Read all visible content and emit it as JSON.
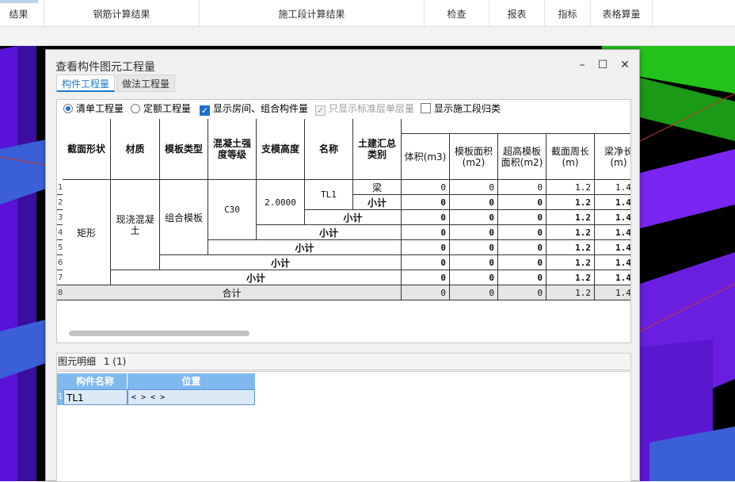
{
  "ribbon": {
    "items": [
      "结果",
      "钢筋计算结果",
      "施工段计算结果",
      "检查",
      "报表",
      "指标",
      "表格算量"
    ]
  },
  "dialog": {
    "title": "查看构件图元工程量",
    "minimize_glyph": "–",
    "maximize_glyph": "☐",
    "close_glyph": "✕",
    "tabs": [
      {
        "label": "构件工程量",
        "active": true
      },
      {
        "label": "做法工程量",
        "active": false
      }
    ],
    "options": [
      {
        "label": "清单工程量",
        "type": "radio",
        "checked": true
      },
      {
        "label": "定额工程量",
        "type": "radio",
        "checked": false
      },
      {
        "label": "显示房间、组合构件量",
        "type": "checkbox",
        "checked": true
      },
      {
        "label": "只显示标准层单层量",
        "type": "checkbox",
        "checked": true,
        "disabled": true
      },
      {
        "label": "显示施工段归类",
        "type": "checkbox",
        "checked": false
      }
    ],
    "table": {
      "headers": [
        "截面形状",
        "材质",
        "模板类型",
        "混凝土强度等级",
        "支模高度",
        "名称",
        "土建汇总类别",
        "体积(m3)",
        "模板面积(m2)",
        "超高模板面积(m2)",
        "截面周长(m)",
        "梁净长(m)"
      ],
      "row_numbers": [
        "1",
        "2",
        "3",
        "4",
        "5",
        "6",
        "7",
        "8"
      ],
      "section_shape": "矩形",
      "material": "现浇混凝土",
      "formwork_type": "组合模板",
      "concrete_grade": "C30",
      "formwork_height": "2.0000",
      "name": "TL1",
      "category": "梁",
      "subtotal_label": "小计",
      "total_label": "合计",
      "rows": [
        {
          "volume": "0",
          "formwork_area": "0",
          "super_area": "0",
          "perimeter": "1.2",
          "length": "1.4"
        },
        {
          "volume": "0",
          "formwork_area": "0",
          "super_area": "0",
          "perimeter": "1.2",
          "length": "1.4"
        },
        {
          "volume": "0",
          "formwork_area": "0",
          "super_area": "0",
          "perimeter": "1.2",
          "length": "1.4"
        },
        {
          "volume": "0",
          "formwork_area": "0",
          "super_area": "0",
          "perimeter": "1.2",
          "length": "1.4"
        },
        {
          "volume": "0",
          "formwork_area": "0",
          "super_area": "0",
          "perimeter": "1.2",
          "length": "1.4"
        },
        {
          "volume": "0",
          "formwork_area": "0",
          "super_area": "0",
          "perimeter": "1.2",
          "length": "1.4"
        },
        {
          "volume": "0",
          "formwork_area": "0",
          "super_area": "0",
          "perimeter": "1.2",
          "length": "1.4"
        },
        {
          "volume": "0",
          "formwork_area": "0",
          "super_area": "0",
          "perimeter": "1.2",
          "length": "1.4"
        }
      ]
    },
    "detail": {
      "label": "图元明细",
      "count": "1 (1)",
      "headers": [
        "构件名称",
        "位置"
      ],
      "row_number": "1",
      "name": "TL1",
      "position": "< > < >"
    }
  },
  "colors": {
    "accent": "#1f7ac8",
    "detail_header": "#7fb9f0",
    "scene_purple": "#6a1fe0",
    "scene_green": "#22c21b"
  }
}
